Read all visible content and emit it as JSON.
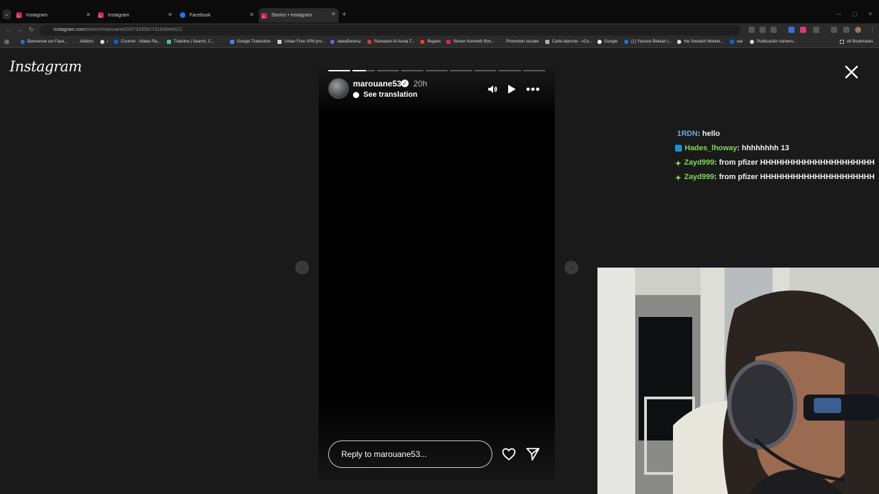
{
  "browser": {
    "tabs": [
      {
        "title": "Instagram",
        "icon": "instagram-icon",
        "active": false
      },
      {
        "title": "Instagram",
        "icon": "instagram-icon",
        "active": false
      },
      {
        "title": "Facebook",
        "icon": "facebook-icon",
        "active": false
      },
      {
        "title": "Stories • Instagram",
        "icon": "instagram-icon",
        "active": true
      }
    ],
    "url_host": "instagram.com",
    "url_path": "/stories/marouane53/3733359273150944621/",
    "bookmarks": [
      "Bienvenue sur Face...",
      "Addons",
      "i",
      "Courrier - Mateo Ra...",
      "Trainline | Search, C...",
      "Google Traduction",
      "Urban Free VPN pro...",
      "Авиабилеты",
      "Ramadan Al Aoula T...",
      "Яндекс",
      "Steven Kenneth Bon...",
      "Promotion sociale",
      "Carte blanche - «Co...",
      "Google",
      "(1) Yassine Bekkari |...",
      "the Swedish Market...",
      "ear",
      "Publicación número..."
    ],
    "all_bookmarks": "All Bookmarks"
  },
  "instagram": {
    "logo": "Instagram",
    "story": {
      "username": "marouane53",
      "time": "20h",
      "translate": "See translation",
      "reply_placeholder": "Reply to marouane53...",
      "segments_total": 9,
      "segments_done": 1,
      "current_segment_progress": 0.6
    }
  },
  "chat": [
    {
      "user": "1RDN",
      "message": ": hello",
      "badge": "none",
      "color": "#6fa8dc"
    },
    {
      "user": "Hades_lhoway",
      "message": ": hhhhhhhh 13",
      "badge": "blue-badge",
      "color": "#7ed957"
    },
    {
      "user": "Zayd999",
      "message": ": from pfizer HHHHHHHHHHHHHHHHHHHHH",
      "badge": "star-badge",
      "color": "#7ed957"
    },
    {
      "user": "Zayd999",
      "message": ": from pfizer HHHHHHHHHHHHHHHHHHHHH",
      "badge": "star-badge",
      "color": "#7ed957"
    }
  ]
}
